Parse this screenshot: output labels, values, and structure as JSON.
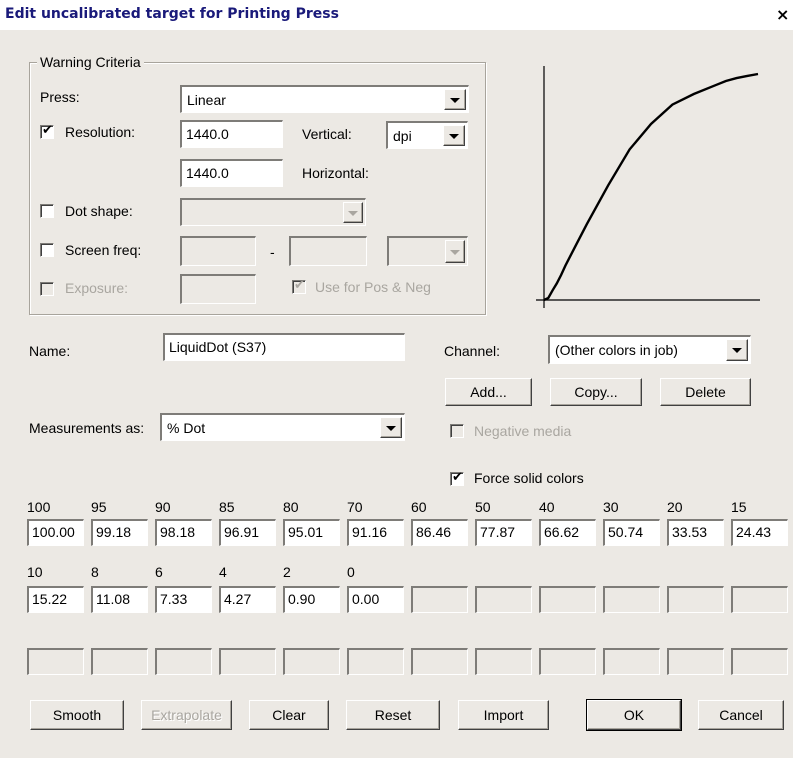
{
  "window": {
    "title": "Edit uncalibrated target for Printing Press",
    "close_glyph": "×"
  },
  "warning_criteria": {
    "legend": "Warning Criteria",
    "press_label": "Press:",
    "press_value": "Linear",
    "resolution_label": "Resolution:",
    "resolution_checked": true,
    "vertical_value": "1440.0",
    "vertical_label": "Vertical:",
    "unit_value": "dpi",
    "horizontal_value": "1440.0",
    "horizontal_label": "Horizontal:",
    "dot_shape_label": "Dot shape:",
    "dot_shape_checked": false,
    "screen_freq_label": "Screen freq:",
    "screen_freq_checked": false,
    "screen_freq_separator": "-",
    "exposure_label": "Exposure:",
    "exposure_checked": false,
    "use_pos_neg_label": "Use for Pos & Neg",
    "use_pos_neg_checked": true
  },
  "name": {
    "label": "Name:",
    "value": "LiquidDot (S37)"
  },
  "channel": {
    "label": "Channel:",
    "value": "(Other colors in job)"
  },
  "buttons": {
    "add": "Add...",
    "copy": "Copy...",
    "delete": "Delete",
    "smooth": "Smooth",
    "extrapolate": "Extrapolate",
    "clear": "Clear",
    "reset": "Reset",
    "import": "Import",
    "ok": "OK",
    "cancel": "Cancel"
  },
  "measurements": {
    "label": "Measurements as:",
    "value": "% Dot"
  },
  "negative_media": {
    "label": "Negative media",
    "checked": false
  },
  "force_solid": {
    "label": "Force solid colors",
    "checked": true
  },
  "grid": {
    "row1_headers": [
      "100",
      "95",
      "90",
      "85",
      "80",
      "70",
      "60",
      "50",
      "40",
      "30",
      "20",
      "15"
    ],
    "row1_values": [
      "100.00",
      "99.18",
      "98.18",
      "96.91",
      "95.01",
      "91.16",
      "86.46",
      "77.87",
      "66.62",
      "50.74",
      "33.53",
      "24.43"
    ],
    "row2_headers": [
      "10",
      "8",
      "6",
      "4",
      "2",
      "0",
      "",
      "",
      "",
      "",
      "",
      ""
    ],
    "row2_values": [
      "15.22",
      "11.08",
      "7.33",
      "4.27",
      "0.90",
      "0.00",
      "",
      "",
      "",
      "",
      "",
      ""
    ],
    "row3_values": [
      "",
      "",
      "",
      "",
      "",
      "",
      "",
      "",
      "",
      "",
      "",
      ""
    ]
  },
  "curve": {
    "points": [
      [
        0,
        0
      ],
      [
        2,
        0.9
      ],
      [
        4,
        4.27
      ],
      [
        6,
        7.33
      ],
      [
        8,
        11.08
      ],
      [
        10,
        15.22
      ],
      [
        15,
        24.43
      ],
      [
        20,
        33.53
      ],
      [
        30,
        50.74
      ],
      [
        40,
        66.62
      ],
      [
        50,
        77.87
      ],
      [
        60,
        86.46
      ],
      [
        70,
        91.16
      ],
      [
        80,
        95.01
      ],
      [
        85,
        96.91
      ],
      [
        90,
        98.18
      ],
      [
        95,
        99.18
      ],
      [
        100,
        100
      ]
    ]
  }
}
